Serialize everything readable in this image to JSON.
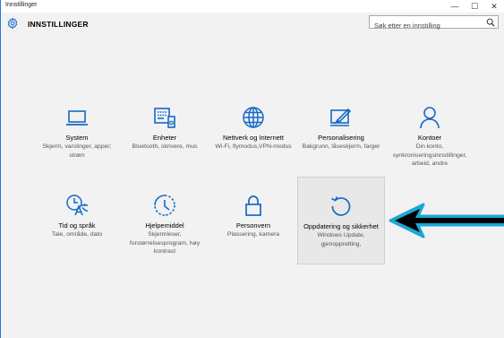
{
  "window": {
    "title": "Innstillinger",
    "controls": {
      "minimize": "—",
      "maximize": "☐",
      "close": "✕"
    }
  },
  "header": {
    "title": "INNSTILLINGER",
    "search_placeholder": "Søk etter en innstilling"
  },
  "tiles": [
    {
      "name": "System",
      "desc": "Skjerm, varslinger, apper; strøm",
      "icon": "laptop-icon"
    },
    {
      "name": "Enheter",
      "desc": "Bluetooth, skrivere, mus",
      "icon": "devices-icon"
    },
    {
      "name": "Nettverk og Internett",
      "desc": "Wi-Fi, flymodus,VPN-modus",
      "icon": "globe-icon"
    },
    {
      "name": "Personalisering",
      "desc": "Bakgrunn, låseskjerm, farger",
      "icon": "paint-icon"
    },
    {
      "name": "Kontoer",
      "desc": "Din konto, synkroniseringsinnstillinger, arbeid, andre",
      "icon": "person-icon"
    },
    {
      "name": "Tid og språk",
      "desc": "Tale, område, dato",
      "icon": "time-language-icon"
    },
    {
      "name": "Hjelpemiddel",
      "desc": "Skjermleser, forstørrelsesprogram, høy kontrast",
      "icon": "ease-of-access-icon"
    },
    {
      "name": "Personvern",
      "desc": "Plassering, kamera",
      "icon": "lock-icon"
    },
    {
      "name": "Oppdatering og sikkerhet",
      "desc": "Windows Update, gjenoppretting,",
      "icon": "refresh-icon"
    }
  ],
  "colors": {
    "accent": "#1569c7",
    "arrow_fill": "#000000",
    "arrow_outline": "#1aa7d6"
  }
}
